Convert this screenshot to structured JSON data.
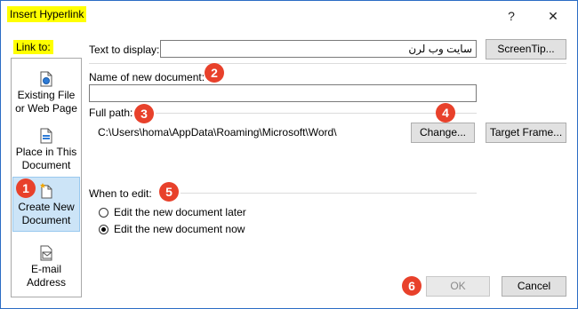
{
  "window": {
    "title": "Insert Hyperlink",
    "help_label": "?",
    "close_label": "✕"
  },
  "sidebar": {
    "header": "Link to:",
    "items": [
      {
        "line1": "Existing File",
        "line2": "or Web Page",
        "icon": "web-page-icon"
      },
      {
        "line1": "Place in This",
        "line2": "Document",
        "icon": "document-place-icon"
      },
      {
        "line1": "Create New",
        "line2": "Document",
        "icon": "new-document-icon",
        "selected": true
      },
      {
        "line1": "E-mail",
        "line2": "Address",
        "icon": "email-icon"
      }
    ]
  },
  "text_to_display": {
    "label": "Text to display:",
    "value": "سایت وب لرن"
  },
  "screentip_label": "ScreenTip...",
  "new_document": {
    "label": "Name of new document:",
    "value": ""
  },
  "full_path": {
    "label": "Full path:",
    "value": "C:\\Users\\homa\\AppData\\Roaming\\Microsoft\\Word\\"
  },
  "change_label": "Change...",
  "target_frame_label": "Target Frame...",
  "when_to_edit": {
    "label": "When to edit:",
    "options": [
      {
        "label": "Edit the new document later",
        "selected": false
      },
      {
        "label": "Edit the new document now",
        "selected": true
      }
    ]
  },
  "ok_label": "OK",
  "cancel_label": "Cancel",
  "badges": [
    "1",
    "2",
    "3",
    "4",
    "5",
    "6"
  ],
  "colors": {
    "highlight": "#ffff00",
    "badge": "#e8412b",
    "selection": "#cce4f7",
    "border": "#2b6cc4"
  }
}
